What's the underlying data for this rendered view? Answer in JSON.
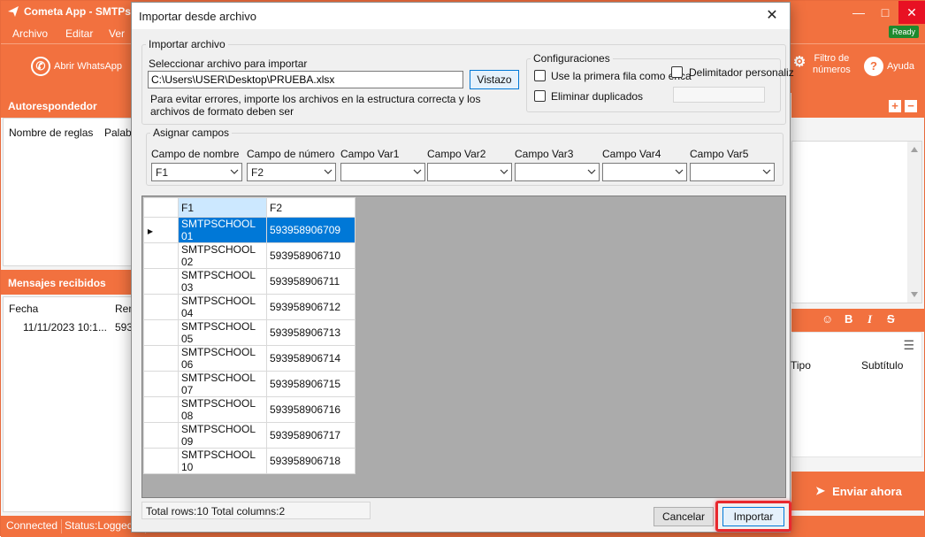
{
  "app": {
    "title": "Cometa App - SMTPs",
    "menu": [
      "Archivo",
      "Editar",
      "Ver"
    ],
    "ready_badge": "Ready",
    "toolbar": {
      "open_whatsapp": "Abrir WhatsApp",
      "filter_numbers_line1": "Filtro de",
      "filter_numbers_line2": "números",
      "help": "Ayuda"
    },
    "autoresponder": {
      "title": "Autorespondedor",
      "col_rules": "Nombre de reglas",
      "col_words": "Palabr"
    },
    "received": {
      "title": "Mensajes recibidos",
      "col_date": "Fecha",
      "col_sender": "Rem",
      "row_date": "11/11/2023 10:1...",
      "row_sender": "593"
    },
    "right_panel": {
      "col_type": "Tipo",
      "col_subtitle": "Subtítulo",
      "send_now": "Enviar ahora"
    },
    "status": {
      "connected": "Connected",
      "status": "Status:Loggedin"
    }
  },
  "dialog": {
    "title": "Importar desde archivo",
    "import_group": {
      "legend": "Importar archivo",
      "select_label": "Seleccionar archivo para importar",
      "path_value": "C:\\Users\\USER\\Desktop\\PRUEBA.xlsx",
      "browse_button": "Vistazo",
      "hint_line1": "Para evitar errores, importe los archivos en la estructura correcta y los",
      "hint_line2": "archivos de formato deben ser"
    },
    "config_group": {
      "legend": "Configuraciones",
      "first_row_header": "Use la primera fila como enca",
      "remove_duplicates": "Eliminar duplicados",
      "custom_delimiter": "Delimitador personaliz"
    },
    "assign_group": {
      "legend": "Asignar campos",
      "fields": [
        {
          "label": "Campo de nombre",
          "value": "F1"
        },
        {
          "label": "Campo de número",
          "value": "F2"
        },
        {
          "label": "Campo Var1",
          "value": ""
        },
        {
          "label": "Campo Var2",
          "value": ""
        },
        {
          "label": "Campo Var3",
          "value": ""
        },
        {
          "label": "Campo Var4",
          "value": ""
        },
        {
          "label": "Campo Var5",
          "value": ""
        }
      ]
    },
    "grid": {
      "columns": [
        "F1",
        "F2"
      ],
      "rows": [
        [
          "SMTPSCHOOL 01",
          "593958906709"
        ],
        [
          "SMTPSCHOOL 02",
          "593958906710"
        ],
        [
          "SMTPSCHOOL 03",
          "593958906711"
        ],
        [
          "SMTPSCHOOL 04",
          "593958906712"
        ],
        [
          "SMTPSCHOOL 05",
          "593958906713"
        ],
        [
          "SMTPSCHOOL 06",
          "593958906714"
        ],
        [
          "SMTPSCHOOL 07",
          "593958906715"
        ],
        [
          "SMTPSCHOOL 08",
          "593958906716"
        ],
        [
          "SMTPSCHOOL 09",
          "593958906717"
        ],
        [
          "SMTPSCHOOL 10",
          "593958906718"
        ]
      ],
      "selected_row": 0
    },
    "summary": "Total rows:10  Total columns:2",
    "cancel_button": "Cancelar",
    "import_button": "Importar"
  },
  "colors": {
    "brand_orange": "#f2713f",
    "selection_blue": "#0078d7",
    "highlight_red": "#e8282e",
    "ready_green": "#1e8a2e"
  }
}
